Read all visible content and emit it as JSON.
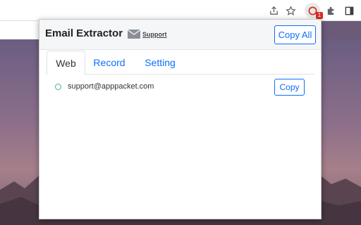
{
  "browser": {
    "toolbar_icons": [
      "share-icon",
      "star-icon",
      "email-extractor-extension-icon",
      "puzzle-icon",
      "side-panel-icon"
    ],
    "extension_badge": "1"
  },
  "popup": {
    "title": "Email Extractor",
    "mail_icon": "envelope-icon",
    "support_label": "Support",
    "copy_all_label": "Copy All",
    "tabs": [
      {
        "label": "Web",
        "active": true
      },
      {
        "label": "Record",
        "active": false
      },
      {
        "label": "Setting",
        "active": false
      }
    ],
    "emails": [
      {
        "address": "support@apppacket.com",
        "copy_label": "Copy"
      }
    ]
  },
  "colors": {
    "accent": "#0d6efd",
    "radio_border": "#3cb39b",
    "badge": "#d62d20"
  }
}
